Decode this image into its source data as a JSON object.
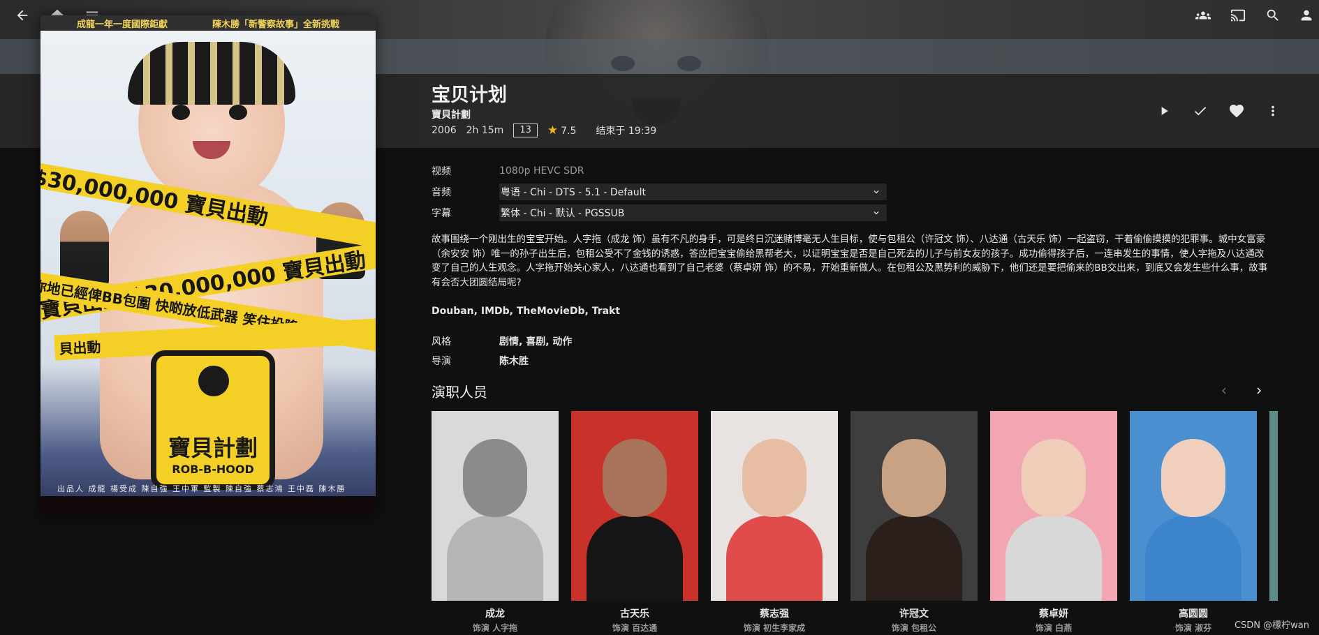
{
  "header": {
    "title": "宝贝计划",
    "original_title": "寶貝計劃",
    "year": "2006",
    "runtime": "2h 15m",
    "rating": "13",
    "community_rating": "7.5",
    "ends_at": "结束于 19:39"
  },
  "poster": {
    "top_line_left": "成龍一年一度國際鉅獻",
    "top_line_right": "陳木勝「新警察故事」全新挑戰",
    "tape_1": "$30,000,000 寶貝出動",
    "tape_2": "寶貝出動  $30,000,000 寶貝出動",
    "tape_3": "你地已經俾BB包圍 快啲放低武器 笑住投降",
    "tape_4": "貝出動",
    "badge_title": "寶貝計劃",
    "badge_eng": "ROB-B-HOOD",
    "credits": "出品人 成龍 楊受成 陳自強 王中軍  監製 陳自強 蔡志鴻 王中磊 陳木勝"
  },
  "topbar_icons": [
    "back-icon",
    "home-icon",
    "menu-icon",
    "users-icon",
    "cast-icon",
    "search-icon",
    "user-icon"
  ],
  "actions_icons": [
    "play-icon",
    "check-icon",
    "heart-icon",
    "more-icon"
  ],
  "details": {
    "video_label": "视频",
    "video_value": "1080p HEVC SDR",
    "audio_label": "音频",
    "audio_value": "粤语 - Chi - DTS - 5.1 - Default",
    "subtitle_label": "字幕",
    "subtitle_value": "繁体 - Chi - 默认 - PGSSUB"
  },
  "overview": "故事围绕一个刚出生的宝宝开始。人字拖（成龙 饰）虽有不凡的身手，可是终日沉迷赌博毫无人生目标，使与包租公（许冠文 饰）、八达通（古天乐 饰）一起盗窃，干着偷偷摸摸的犯罪事。城中女富豪（余安安 饰）唯一的孙子出生后，包租公受不了金钱的诱惑，答应把宝宝偷给黑帮老大，以证明宝宝是否是自己死去的儿子与前女友的孩子。成功偷得孩子后，一连串发生的事情，使人字拖及八达通改变了自己的人生观念。人字拖开始关心家人，八达通也看到了自己老婆（蔡卓妍 饰）的不易，开始重新做人。在包租公及黑势利的威胁下，他们还是要把偷来的BB交出来，到底又会发生些什么事，故事有会否大团圆结局呢?",
  "external_links": {
    "douban": "Douban",
    "imdb": "IMDb",
    "tmdb": "TheMovieDb",
    "trakt": "Trakt"
  },
  "genres_label": "风格",
  "genres_value": "剧情, 喜剧, 动作",
  "director_label": "导演",
  "director_value": "陈木胜",
  "cast_heading": "演职人员",
  "cast": [
    {
      "name": "成龙",
      "role": "饰演 人字拖",
      "bg": "#d9d9d9",
      "skin": "#8b8b8b",
      "cloth": "#b5b5b5"
    },
    {
      "name": "古天乐",
      "role": "饰演 百达通",
      "bg": "#c8322b",
      "skin": "#a8735a",
      "cloth": "#161616"
    },
    {
      "name": "蔡志强",
      "role": "饰演 初生李家成",
      "bg": "#e8e3e1",
      "skin": "#e7bda4",
      "cloth": "#e04c4c"
    },
    {
      "name": "许冠文",
      "role": "饰演 包租公",
      "bg": "#3e3e3e",
      "skin": "#c9a183",
      "cloth": "#2a1f1a"
    },
    {
      "name": "蔡卓妍",
      "role": "饰演 白燕",
      "bg": "#f2a6b1",
      "skin": "#efcdb9",
      "cloth": "#d8d8d8"
    },
    {
      "name": "高圆圆",
      "role": "饰演 淑芬",
      "bg": "#4a8fd0",
      "skin": "#f0d0bc",
      "cloth": "#3c84cc"
    }
  ],
  "watermark": "CSDN @檬柠wan"
}
